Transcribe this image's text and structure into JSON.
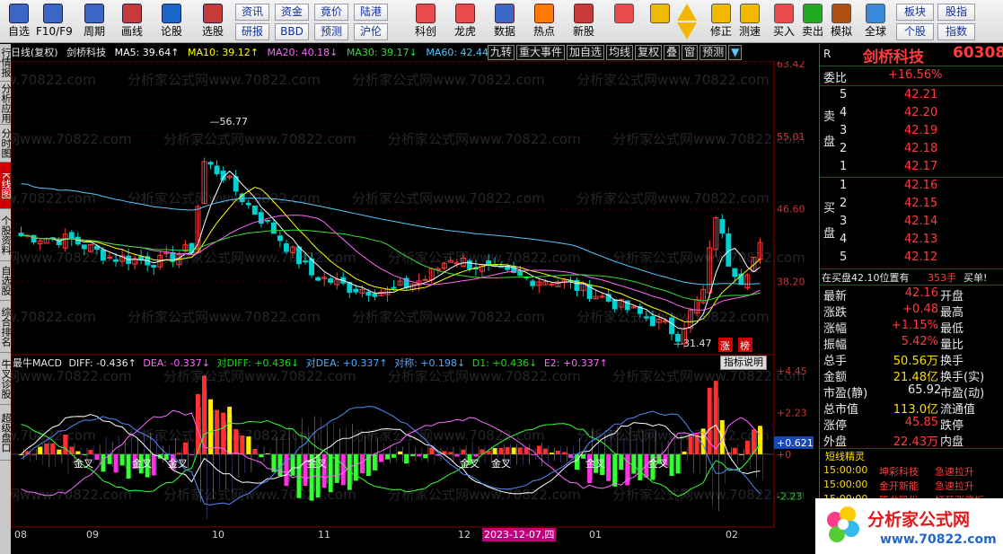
{
  "toolbar": {
    "big_buttons": [
      {
        "label": "自选",
        "icon": "grid-icon"
      },
      {
        "label": "F10/F9",
        "icon": "f10-icon"
      },
      {
        "label": "周期",
        "icon": "clock-icon"
      },
      {
        "label": "画线",
        "icon": "pencil-icon"
      },
      {
        "label": "论股",
        "icon": "discuss-icon"
      },
      {
        "label": "选股",
        "icon": "gauge-icon"
      }
    ],
    "small_buttons_top": [
      "资讯",
      "资金",
      "竟价",
      "陆港"
    ],
    "small_buttons_bottom": [
      "研报",
      "BBD",
      "预测",
      "沪伦"
    ],
    "mid_buttons": [
      {
        "label": "科创",
        "icon": "chart-icon"
      },
      {
        "label": "龙虎",
        "icon": "dragon-icon"
      },
      {
        "label": "数据",
        "icon": "pe-icon"
      },
      {
        "label": "热点",
        "icon": "flame-icon"
      },
      {
        "label": "新股",
        "icon": "ipo-icon"
      }
    ],
    "nav_buttons": [
      {
        "label": "",
        "icon": "windows-grid-icon"
      },
      {
        "label": "",
        "icon": "back-arrow-icon"
      },
      {
        "label": "修正",
        "icon": "fix-icon"
      },
      {
        "label": "测速",
        "icon": "speed-icon"
      },
      {
        "label": "买入",
        "icon": "buy-icon"
      },
      {
        "label": "卖出",
        "icon": "sell-icon"
      },
      {
        "label": "模拟",
        "icon": "hammer-icon"
      },
      {
        "label": "全球",
        "icon": "globe-icon"
      }
    ],
    "right_small_top": [
      "板块",
      "股指"
    ],
    "right_small_bottom": [
      "个股",
      "指数"
    ]
  },
  "left_tabs": [
    "行情报价",
    "分析应用",
    "分时图",
    "K线图",
    "个股资料",
    "自选股",
    "综合排名",
    "牛叉诊股",
    "超级盘口"
  ],
  "header": {
    "period": "日线(复权)",
    "name": "剑桥科技",
    "ma5": "MA5: 39.64↑",
    "ma10": "MA10: 39.12↑",
    "ma20": "MA20: 40.18↓",
    "ma30": "MA30: 39.17↓",
    "ma60": "MA60: 42.44↓"
  },
  "event_buttons": [
    "九转",
    "重大事件",
    "加自选",
    "均线",
    "复权",
    "叠",
    "窗",
    "预测"
  ],
  "k_price_axis": [
    "63.42",
    "55.01",
    "46.60",
    "38.20"
  ],
  "k_annotations": {
    "high": "56.77",
    "low": "31.47",
    "zhang": "涨",
    "bang": "榜"
  },
  "macd_header": {
    "name": "最牛MACD",
    "diff": "DIFF: -0.436↑",
    "dea": "DEA: -0.337↓",
    "diff2": "对DIFF: +0.436↓",
    "dea2": "对DEA: +0.337↑",
    "sym": "对称: +0.198↓",
    "d1": "D1: +0.436↓",
    "e2": "E2: +0.337↑"
  },
  "indicator_button": "指标说明",
  "macd_axis": [
    "+4.45",
    "+2.23",
    "+0.621",
    "+0",
    "-2.23"
  ],
  "macd_cross_labels": [
    "金叉",
    "金叉",
    "金叉",
    "金叉",
    "金叉",
    "金叉",
    "金叉",
    "金叉"
  ],
  "time_axis": [
    "08",
    "09",
    "10",
    "11",
    "12",
    "01",
    "02"
  ],
  "cursor_date": "2023-12-07,四",
  "rpanel": {
    "r_tag": "R",
    "title": "剑桥科技",
    "code": "60308",
    "weibi_label": "委比",
    "weibi_value": "+16.56%",
    "sell_label": "卖盘",
    "buy_label": "买盘",
    "sells": [
      {
        "lvl": "5",
        "price": "42.21",
        "vol": ""
      },
      {
        "lvl": "4",
        "price": "42.20",
        "vol": ""
      },
      {
        "lvl": "3",
        "price": "42.19",
        "vol": ""
      },
      {
        "lvl": "2",
        "price": "42.18",
        "vol": ""
      },
      {
        "lvl": "1",
        "price": "42.17",
        "vol": ""
      }
    ],
    "buys": [
      {
        "lvl": "1",
        "price": "42.16",
        "vol": ""
      },
      {
        "lvl": "2",
        "price": "42.15",
        "vol": ""
      },
      {
        "lvl": "3",
        "price": "42.14",
        "vol": ""
      },
      {
        "lvl": "4",
        "price": "42.13",
        "vol": ""
      },
      {
        "lvl": "5",
        "price": "42.12",
        "vol": ""
      }
    ],
    "position_text": "在买盘42.10位置有",
    "position_vol": "353手",
    "position_tag": "买单!",
    "stats": [
      {
        "label": "最新",
        "value": "42.16",
        "cls": "red",
        "label2": "开盘"
      },
      {
        "label": "涨跌",
        "value": "+0.48",
        "cls": "red",
        "label2": "最高"
      },
      {
        "label": "涨幅",
        "value": "+1.15%",
        "cls": "red",
        "label2": "最低"
      },
      {
        "label": "振幅",
        "value": "5.42%",
        "cls": "red",
        "label2": "量比"
      },
      {
        "label": "总手",
        "value": "50.56万",
        "cls": "yellow",
        "label2": "换手"
      },
      {
        "label": "金额",
        "value": "21.48亿",
        "cls": "yellow",
        "label2": "换手(实)"
      },
      {
        "label": "市盈(静)",
        "value": "65.92",
        "cls": "white",
        "label2": "市盈(动)"
      },
      {
        "label": "总市值",
        "value": "113.0亿",
        "cls": "yellow",
        "label2": "流通值"
      },
      {
        "label": "涨停",
        "value": "45.85",
        "cls": "red",
        "label2": "跌停"
      },
      {
        "label": "外盘",
        "value": "22.43万",
        "cls": "red",
        "label2": "内盘"
      }
    ],
    "sprite_title": "短线精灵",
    "sprites": [
      {
        "time": "15:00:00",
        "name": "坤彩科技",
        "event": "急速拉升"
      },
      {
        "time": "15:00:00",
        "name": "金开新能",
        "event": "急速拉升"
      },
      {
        "time": "15:00:00",
        "name": "腾龙股份",
        "event": "打开涨停板"
      }
    ]
  },
  "watermark": "分析家公式网www.70822.com",
  "logo": {
    "brand": "分析家公式网",
    "url": "www.70822.com"
  },
  "colors": {
    "up": "#ff3b3b",
    "down": "#00d0d0",
    "ma5": "#ffffff",
    "ma10": "#ffff00",
    "ma20": "#ff66ff",
    "ma30": "#33dd33",
    "ma60": "#55c8ff"
  }
}
